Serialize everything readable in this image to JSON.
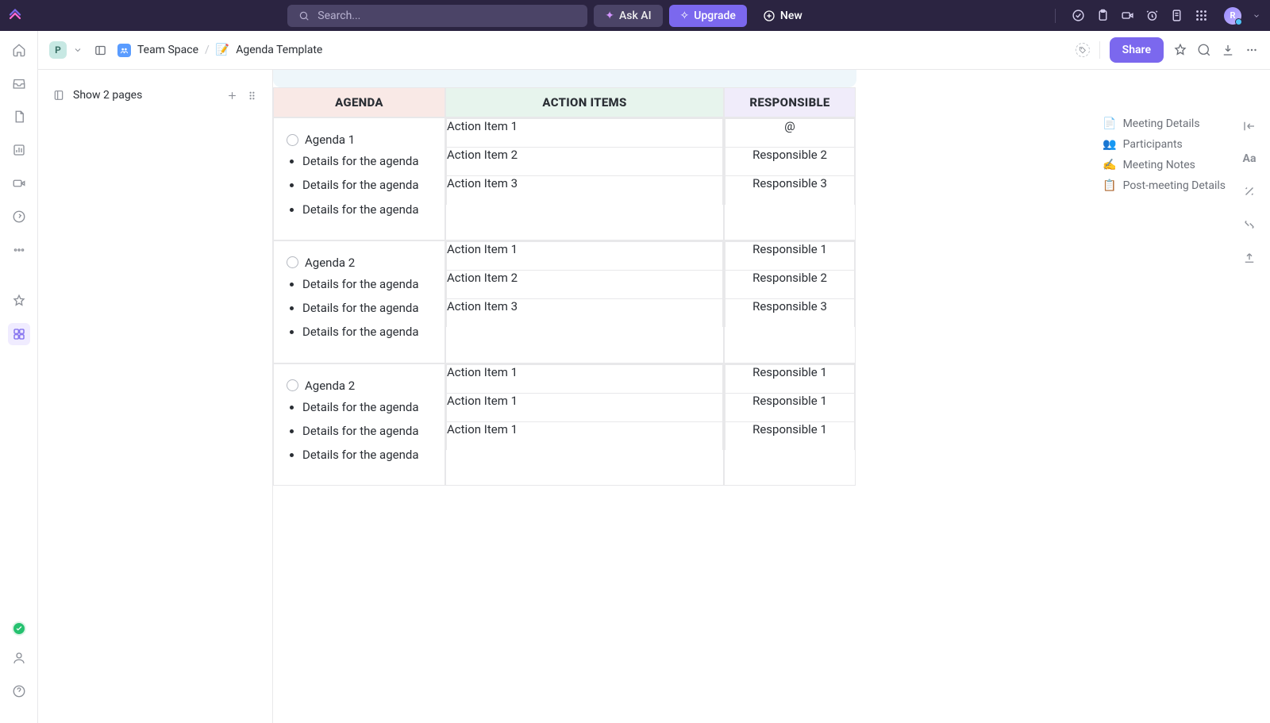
{
  "topbar": {
    "search_placeholder": "Search...",
    "ask_ai": "Ask AI",
    "upgrade": "Upgrade",
    "new": "New",
    "avatar_initial": "R"
  },
  "breadcrumb": {
    "workspace_initial": "P",
    "space": "Team Space",
    "page_icon": "📝",
    "page": "Agenda Template"
  },
  "toolbar": {
    "share": "Share"
  },
  "leftpanel": {
    "show_pages": "Show 2 pages"
  },
  "table": {
    "headers": {
      "agenda": "AGENDA",
      "action": "ACTION ITEMS",
      "responsible": "RESPONSIBLE"
    },
    "rows": [
      {
        "title": "Agenda 1",
        "details": [
          "Details for the agen­da",
          "Details for the agen­da",
          "Details for the agen­da"
        ],
        "actions": [
          "Action Item 1",
          "Action Item 2",
          "Action Item 3"
        ],
        "responsible": [
          "@",
          "Responsible 2",
          "Responsible 3"
        ]
      },
      {
        "title": "Agenda 2",
        "details": [
          "Details for the agen­da",
          "Details for the agen­da",
          "Details for the agen­da"
        ],
        "actions": [
          "Action Item 1",
          "Action Item 2",
          "Action Item 3"
        ],
        "responsible": [
          "Responsible 1",
          "Responsible 2",
          "Responsible 3"
        ]
      },
      {
        "title": "Agenda 2",
        "details": [
          "Details for the agen­da",
          "Details for the agen­da",
          "Details for the agen­da"
        ],
        "actions": [
          "Action Item 1",
          "Action Item 1",
          "Action Item 1"
        ],
        "responsible": [
          "Responsible 1",
          "Responsible 1",
          "Responsible 1"
        ]
      }
    ]
  },
  "outline": [
    {
      "icon": "📄",
      "label": "Meeting Details"
    },
    {
      "icon": "👥",
      "label": "Participants"
    },
    {
      "icon": "✍️",
      "label": "Meeting Notes"
    },
    {
      "icon": "📋",
      "label": "Post-meeting Details"
    }
  ],
  "rightrail": {
    "aa": "Aa"
  }
}
